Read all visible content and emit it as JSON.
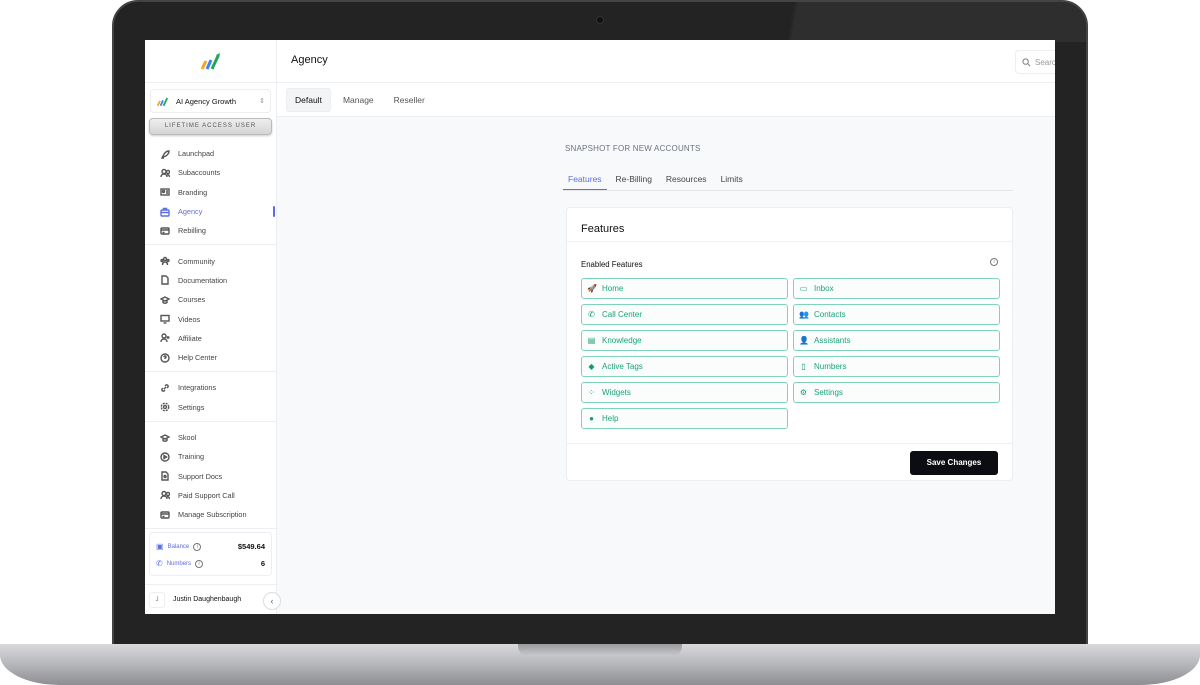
{
  "app": {
    "brand_colors": {
      "accent": "#5b6ee1",
      "feature": "#16a37a",
      "button": "#0b0d12"
    }
  },
  "sidebar": {
    "account_name": "AI Agency Growth",
    "lifetime_badge": "LIFETIME ACCESS USER",
    "groups": [
      [
        {
          "label": "Launchpad",
          "icon": "rocket-icon"
        },
        {
          "label": "Subaccounts",
          "icon": "users-icon"
        },
        {
          "label": "Branding",
          "icon": "id-card-icon"
        },
        {
          "label": "Agency",
          "icon": "briefcase-icon",
          "active": true
        },
        {
          "label": "Rebilling",
          "icon": "credit-card-icon"
        }
      ],
      [
        {
          "label": "Community",
          "icon": "community-icon"
        },
        {
          "label": "Documentation",
          "icon": "file-icon"
        },
        {
          "label": "Courses",
          "icon": "graduation-cap-icon"
        },
        {
          "label": "Videos",
          "icon": "monitor-icon"
        },
        {
          "label": "Affiliate",
          "icon": "user-plus-icon"
        },
        {
          "label": "Help Center",
          "icon": "help-circle-icon"
        }
      ],
      [
        {
          "label": "Integrations",
          "icon": "link-icon"
        },
        {
          "label": "Settings",
          "icon": "gear-icon"
        }
      ],
      [
        {
          "label": "Skool",
          "icon": "graduation-cap-icon"
        },
        {
          "label": "Training",
          "icon": "play-circle-icon"
        },
        {
          "label": "Support Docs",
          "icon": "file-search-icon"
        },
        {
          "label": "Paid Support Call",
          "icon": "users-icon"
        },
        {
          "label": "Manage Subscription",
          "icon": "credit-card-icon"
        }
      ]
    ],
    "balance_label": "Balance",
    "balance_value": "$549.64",
    "numbers_label": "Numbers",
    "numbers_value": "6",
    "user_initial": "J",
    "user_name": "Justin Daughenbaugh"
  },
  "header": {
    "title": "Agency",
    "search_placeholder": "Search"
  },
  "tabs": [
    {
      "label": "Default",
      "active": true
    },
    {
      "label": "Manage"
    },
    {
      "label": "Reseller"
    }
  ],
  "main": {
    "section_title": "SNAPSHOT FOR NEW ACCOUNTS",
    "subtabs": [
      {
        "label": "Features",
        "active": true
      },
      {
        "label": "Re-Billing"
      },
      {
        "label": "Resources"
      },
      {
        "label": "Limits"
      }
    ],
    "card_title": "Features",
    "enabled_label": "Enabled Features",
    "features": [
      {
        "label": "Home",
        "icon": "rocket-icon",
        "glyph": "🚀"
      },
      {
        "label": "Inbox",
        "icon": "inbox-icon",
        "glyph": "▭"
      },
      {
        "label": "Call Center",
        "icon": "phone-icon",
        "glyph": "✆"
      },
      {
        "label": "Contacts",
        "icon": "users-icon",
        "glyph": "👥"
      },
      {
        "label": "Knowledge",
        "icon": "database-icon",
        "glyph": "▤"
      },
      {
        "label": "Assistants",
        "icon": "user-icon",
        "glyph": "👤"
      },
      {
        "label": "Active Tags",
        "icon": "tag-icon",
        "glyph": "◆"
      },
      {
        "label": "Numbers",
        "icon": "mobile-icon",
        "glyph": "▯"
      },
      {
        "label": "Widgets",
        "icon": "grid-icon",
        "glyph": "⁘"
      },
      {
        "label": "Settings",
        "icon": "gear-icon",
        "glyph": "⚙"
      },
      {
        "label": "Help",
        "icon": "question-circle-icon",
        "glyph": "●"
      }
    ],
    "save_label": "Save Changes"
  }
}
